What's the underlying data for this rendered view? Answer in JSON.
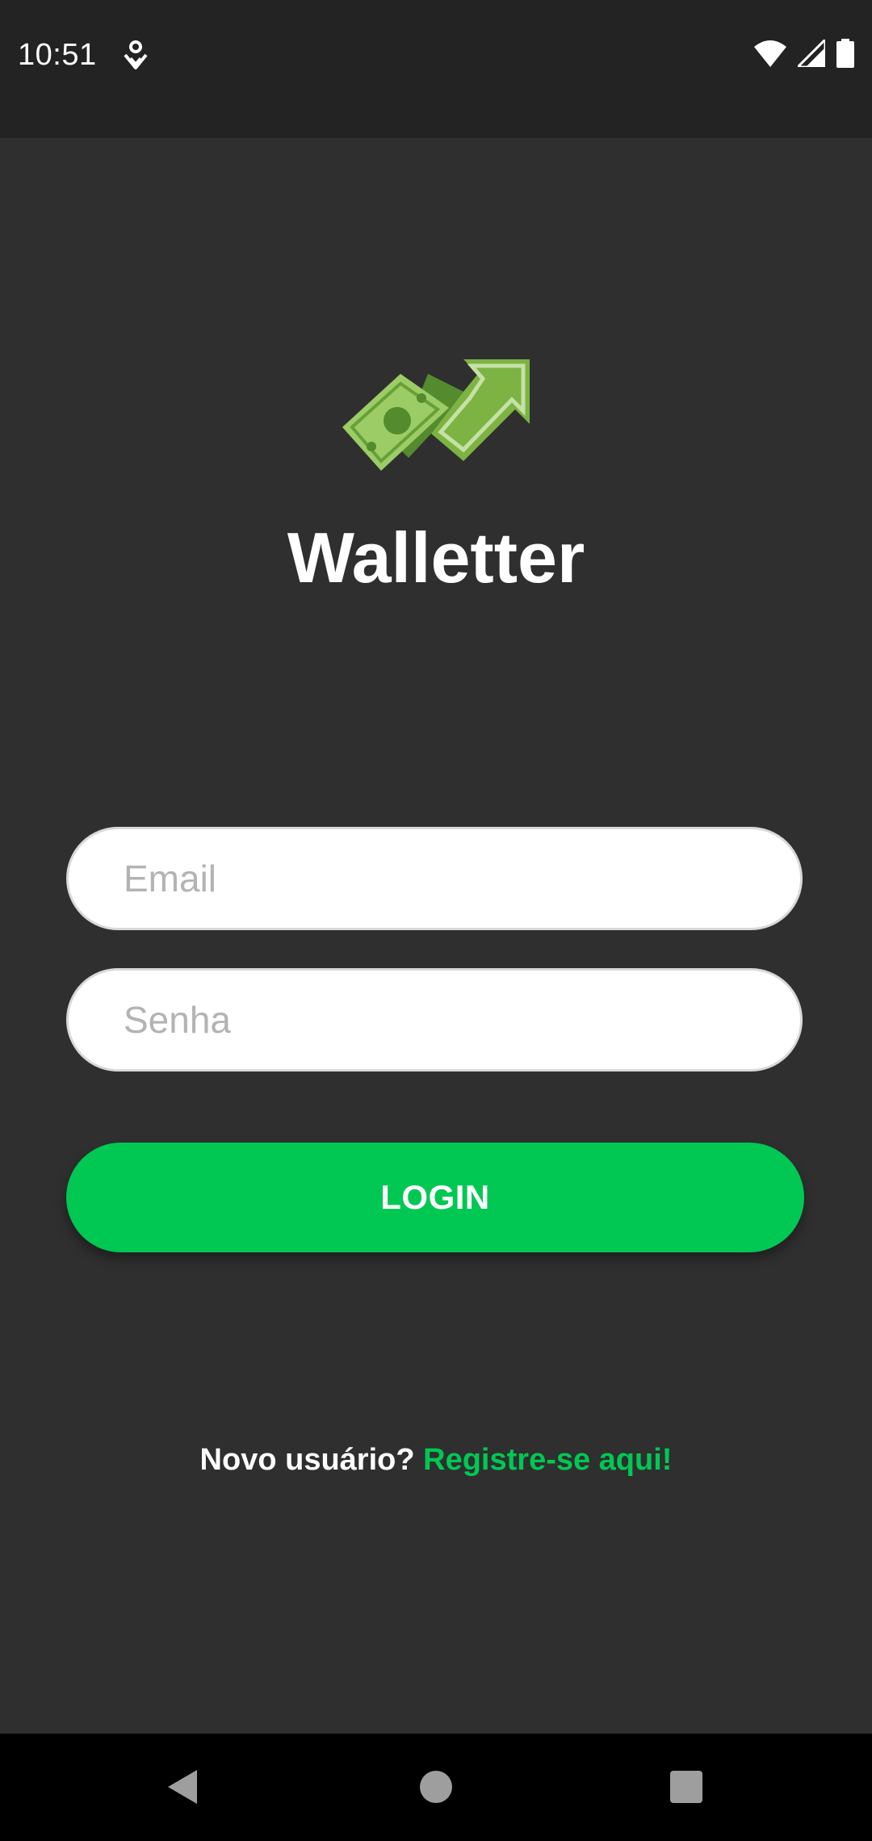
{
  "status_bar": {
    "time": "10:51",
    "icons": [
      "location-notification-icon",
      "wifi-icon",
      "signal-icon",
      "battery-icon"
    ]
  },
  "app": {
    "title": "Walletter",
    "logo": "money-growth-logo"
  },
  "form": {
    "email_placeholder": "Email",
    "password_placeholder": "Senha",
    "login_label": "LOGIN"
  },
  "register": {
    "prompt": "Novo usuário?",
    "link": "Registre-se aqui!"
  },
  "nav_bar": {
    "icons": [
      "back-icon",
      "home-icon",
      "recents-icon"
    ]
  },
  "colors": {
    "background": "#2f2f2f",
    "status_bar": "#232323",
    "accent": "#00c853",
    "logo_light": "#9ccc65",
    "logo_dark": "#558b2f"
  }
}
